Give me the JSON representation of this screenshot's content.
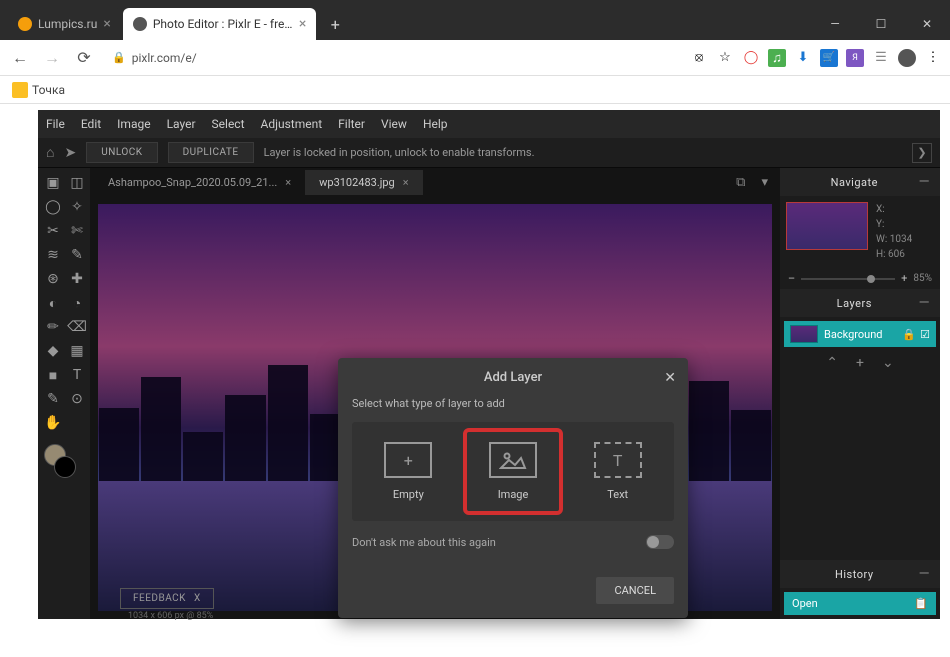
{
  "browser": {
    "tabs": [
      {
        "title": "Lumpics.ru",
        "favicon_color": "#f59e0b"
      },
      {
        "title": "Photo Editor : Pixlr E - free imag...",
        "favicon_color": "#555"
      }
    ],
    "url": "pixlr.com/e/",
    "bookmark": "Точка",
    "window_controls": {
      "min": "—",
      "max": "☐",
      "close": "✕"
    }
  },
  "app": {
    "menu": [
      "File",
      "Edit",
      "Image",
      "Layer",
      "Select",
      "Adjustment",
      "Filter",
      "View",
      "Help"
    ],
    "toolbar": {
      "unlock": "UNLOCK",
      "duplicate": "DUPLICATE",
      "hint": "Layer is locked in position, unlock to enable transforms."
    },
    "file_tabs": [
      {
        "name": "Ashampoo_Snap_2020.05.09_21...",
        "active": false
      },
      {
        "name": "wp3102483.jpg",
        "active": true
      }
    ],
    "feedback": {
      "label": "FEEDBACK",
      "close": "X"
    },
    "canvas_info": "1034 x 606 px @ 85%"
  },
  "panels": {
    "navigate": {
      "title": "Navigate",
      "labels": {
        "x": "X:",
        "y": "Y:",
        "w": "W:",
        "h": "H:"
      },
      "w": "1034",
      "h": "606",
      "zoom": "85%"
    },
    "layers": {
      "title": "Layers",
      "items": [
        {
          "name": "Background"
        }
      ]
    },
    "history": {
      "title": "History",
      "items": [
        {
          "name": "Open"
        }
      ]
    }
  },
  "modal": {
    "title": "Add Layer",
    "subtitle": "Select what type of layer to add",
    "options": [
      {
        "key": "empty",
        "label": "Empty"
      },
      {
        "key": "image",
        "label": "Image"
      },
      {
        "key": "text",
        "label": "Text"
      }
    ],
    "no_ask": "Don't ask me about this again",
    "cancel": "CANCEL"
  }
}
